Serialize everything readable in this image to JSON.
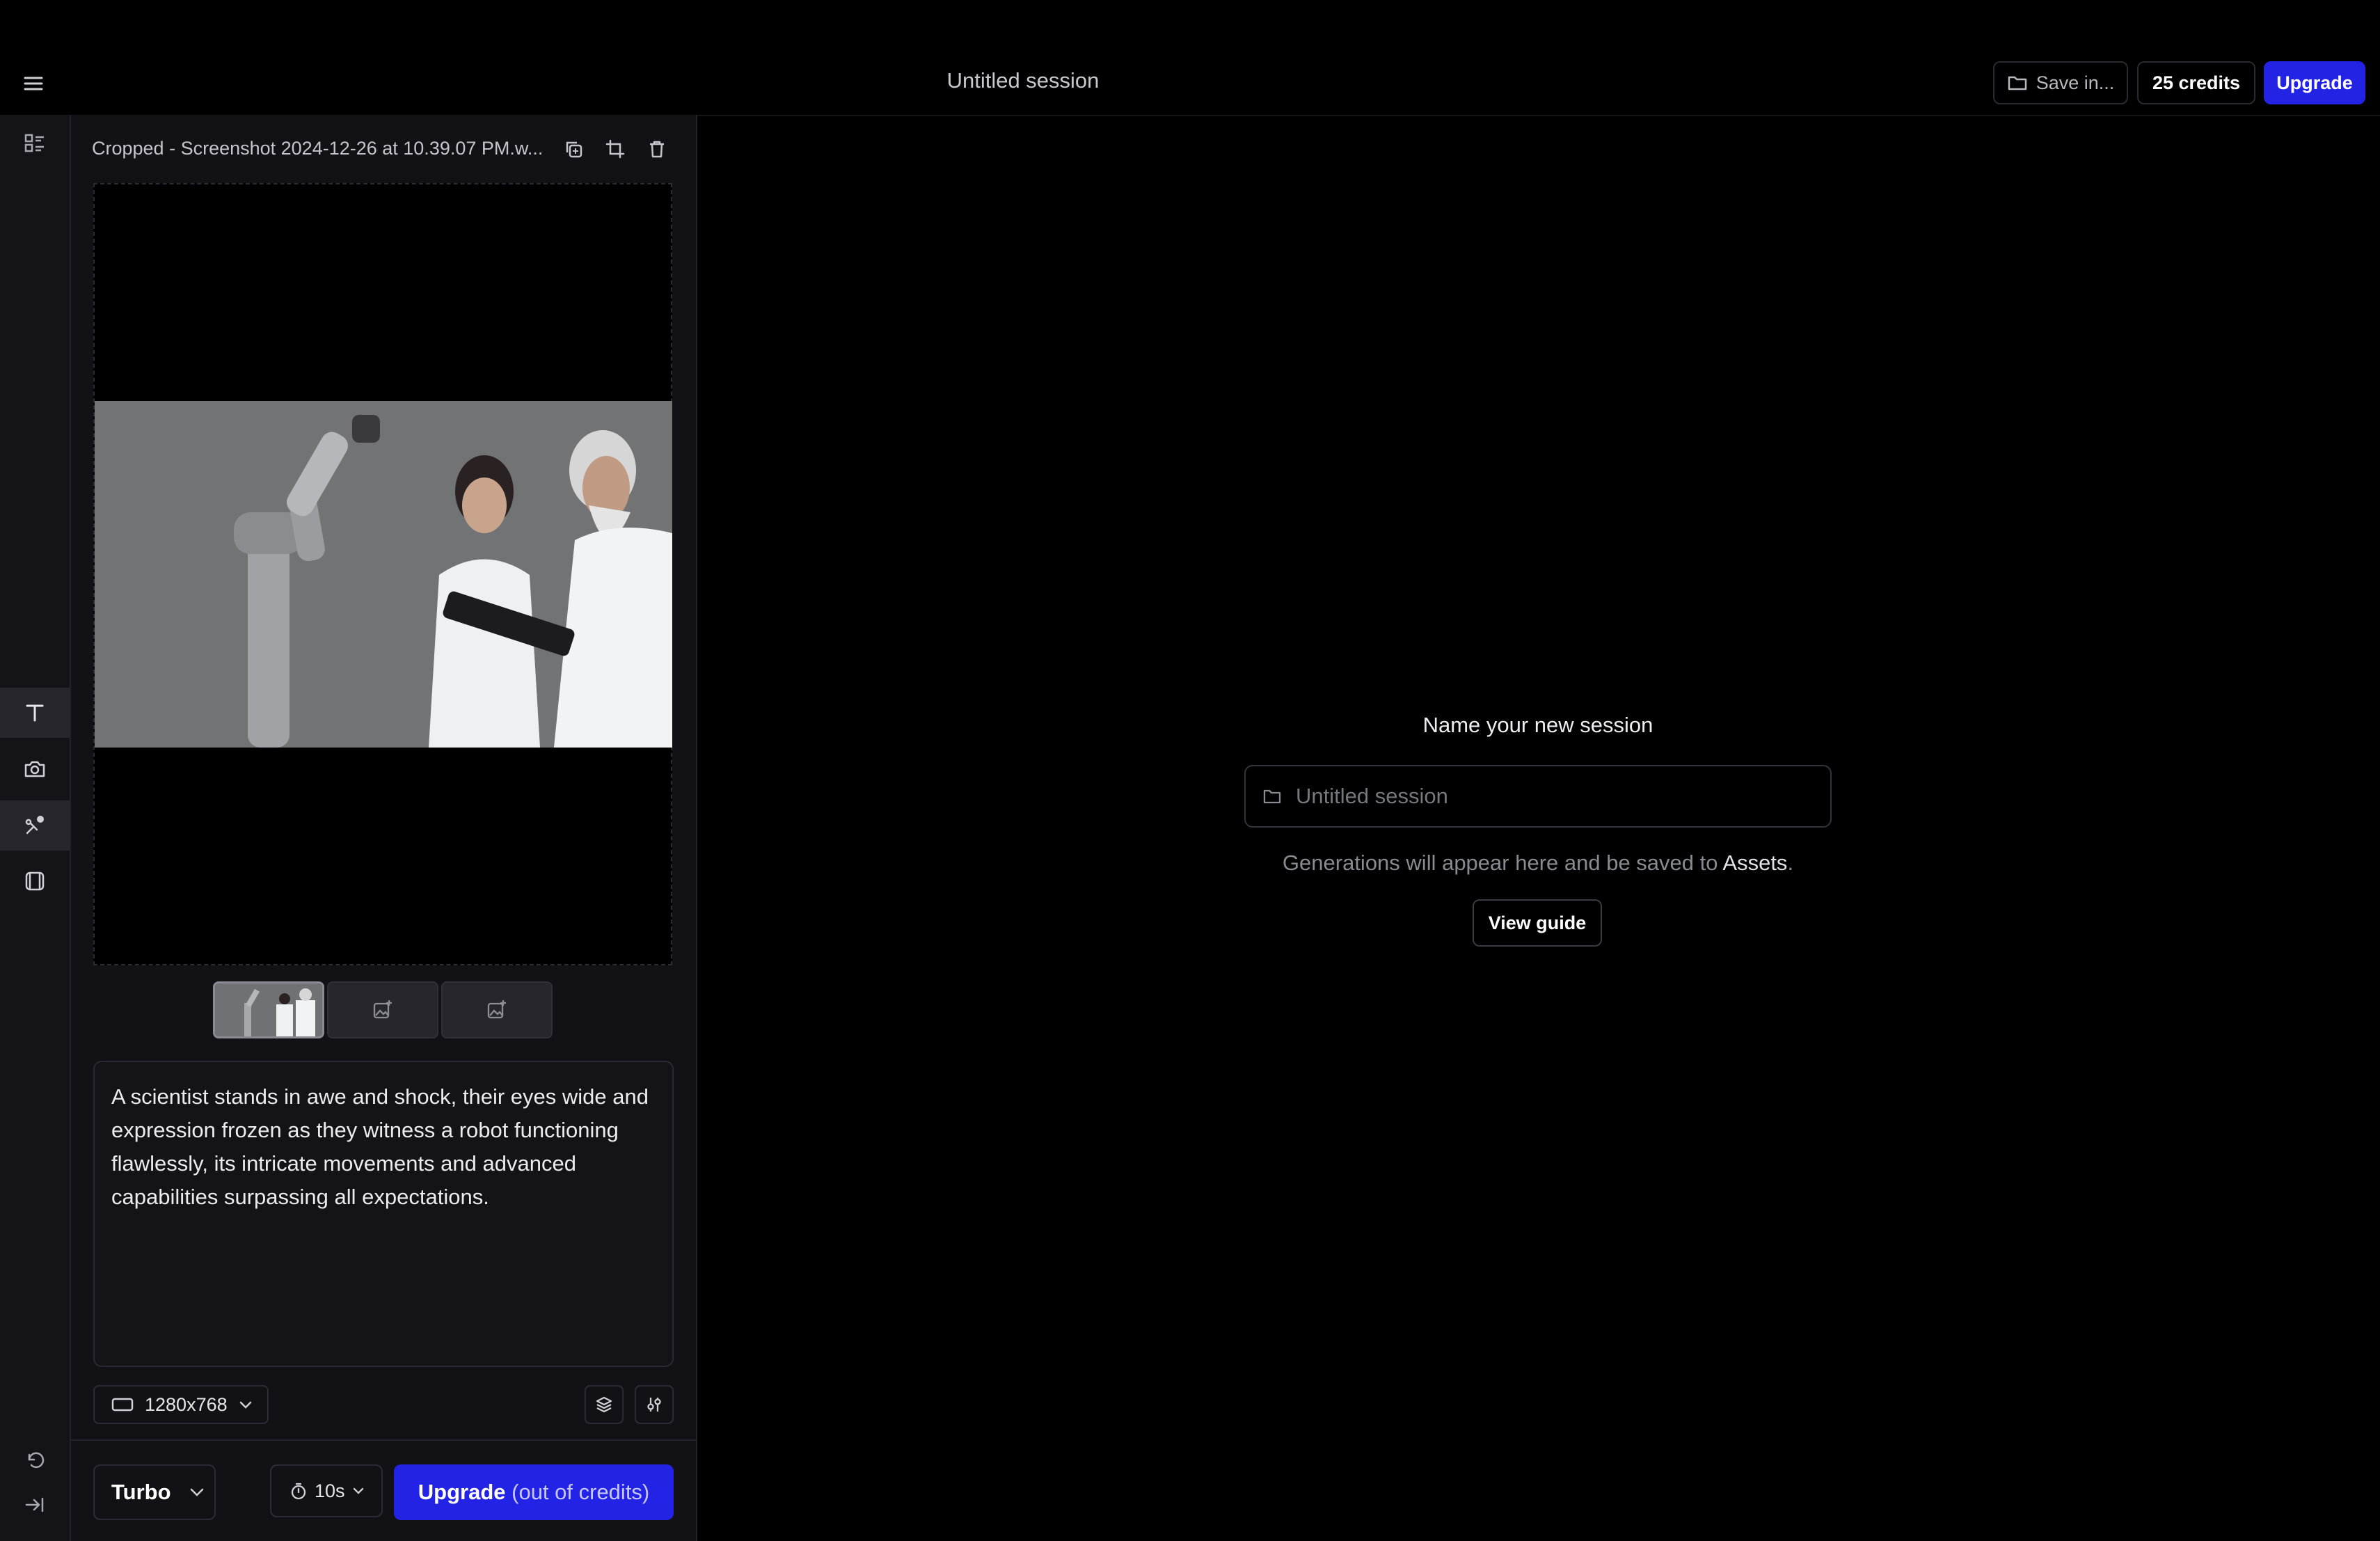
{
  "header": {
    "title": "Untitled session",
    "save_label": "Save in...",
    "credits_label": "25 credits",
    "upgrade_label": "Upgrade"
  },
  "rail": {
    "icons": [
      "menu-icon",
      "gallery-icon",
      "text-icon",
      "camera-icon",
      "motion-icon",
      "frames-icon",
      "undo-icon",
      "collapse-icon"
    ]
  },
  "editor": {
    "file_name": "Cropped - Screenshot 2024-12-26 at 10.39.07 PM.w...",
    "prompt": "A scientist stands in awe and shock, their eyes wide and expression frozen as they witness a robot functioning flawlessly, its intricate movements and advanced capabilities surpassing all expectations.",
    "resolution": "1280x768",
    "model": "Turbo",
    "duration": "10s",
    "upgrade_main": "Upgrade",
    "upgrade_note": "(out of credits)"
  },
  "main": {
    "heading": "Name your new session",
    "session_placeholder": "Untitled session",
    "hint_prefix": "Generations will appear here and be saved to ",
    "hint_link": "Assets",
    "hint_suffix": ".",
    "guide_label": "View guide"
  },
  "colors": {
    "accent": "#2323e6",
    "background": "#000000",
    "panel": "#121216"
  }
}
